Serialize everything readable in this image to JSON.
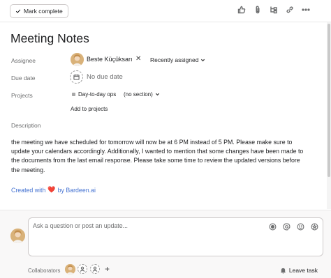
{
  "toolbar": {
    "mark_complete": "Mark complete",
    "icons": [
      "thumbs-up-icon",
      "attachment-icon",
      "subtask-icon",
      "link-icon",
      "more-icon"
    ]
  },
  "task": {
    "title": "Meeting Notes",
    "assignee_label": "Assignee",
    "assignee_name": "Beste Küçüksarı",
    "remove": "✕",
    "recently_assigned": "Recently assigned",
    "due_date_label": "Due date",
    "due_date_value": "No due date",
    "projects_label": "Projects",
    "project_name": "Day-to-day ops",
    "section": "(no section)",
    "add_to_projects": "Add to projects",
    "description_label": "Description",
    "description": " the meeting we have scheduled for tomorrow will now be at 6 PM instead of 5 PM. Please make sure to update your calendars accordingly. Additionally, I wanted to mention that some changes have been made to the documents from the last email response. Please take some time to review the updated versions before the meeting.",
    "created_prefix": "Created with",
    "created_heart": "❤️",
    "created_suffix": "by Bardeen.ai"
  },
  "composer": {
    "placeholder": "Ask a question or post an update...",
    "collaborators_label": "Collaborators",
    "add_collaborator": "+",
    "leave_task": "Leave task"
  },
  "colors": {
    "accent_link": "#4573d2",
    "heart": "#e8384f",
    "text": "#1e1f21",
    "muted": "#6d6e6f"
  }
}
